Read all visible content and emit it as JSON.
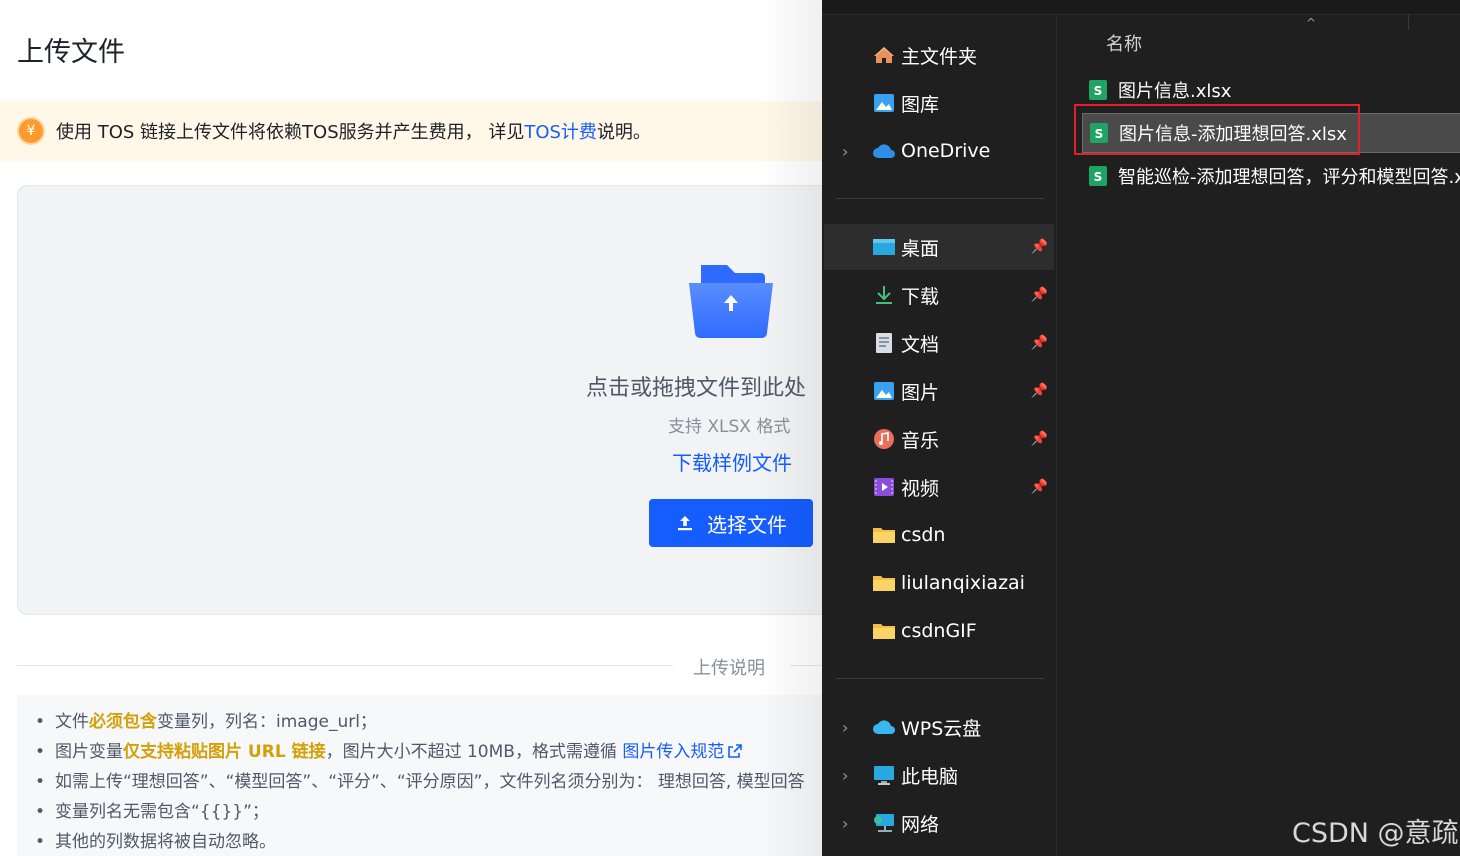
{
  "web": {
    "title": "上传文件",
    "notice": {
      "icon": "yen-icon",
      "text_before": "使用 TOS 链接上传文件将依赖TOS服务并产生费用， 详见 ",
      "link": "TOS计费",
      "text_after": " 说明。"
    },
    "dropzone": {
      "primary_text": "点击或拖拽文件到此处",
      "format_hint": "支持 XLSX 格式",
      "sample_link": "下载样例文件",
      "choose_button": "选择文件"
    },
    "divider_label": "上传说明",
    "notes": {
      "n1": {
        "a": "文件",
        "b": "必须包含",
        "c": "变量列，列名：image_url；"
      },
      "n2": {
        "a": "图片变量",
        "b": "仅支持粘贴图片 URL 链接",
        "c": "，图片大小不超过 10MB，格式需遵循 ",
        "d": "图片传入规范"
      },
      "n3": "如需上传“理想回答”、“模型回答”、“评分”、“评分原因”，文件列名须分别为： 理想回答, 模型回答",
      "n4": "变量列名无需包含“{{}}”；",
      "n5": "其他的列数据将被自动忽略。"
    },
    "colors": {
      "primary": "#165dff",
      "notice_bg": "#fff7e8",
      "highlight": "#d4a007"
    }
  },
  "explorer": {
    "nav": {
      "home": "主文件夹",
      "gallery": "图库",
      "onedrive": "OneDrive",
      "desktop": "桌面",
      "downloads": "下载",
      "documents": "文档",
      "pictures": "图片",
      "music": "音乐",
      "videos": "视频",
      "csdn": "csdn",
      "liulan": "liulanqixiazai",
      "csdngif": "csdnGIF",
      "wps": "WPS云盘",
      "thispc": "此电脑",
      "network": "网络"
    },
    "column_header": "名称",
    "files": [
      "图片信息.xlsx",
      "图片信息-添加理想回答.xlsx",
      "智能巡检-添加理想回答，评分和模型回答.xlsx"
    ],
    "highlight_color": "#e0202a"
  },
  "watermark": "CSDN @意疏"
}
